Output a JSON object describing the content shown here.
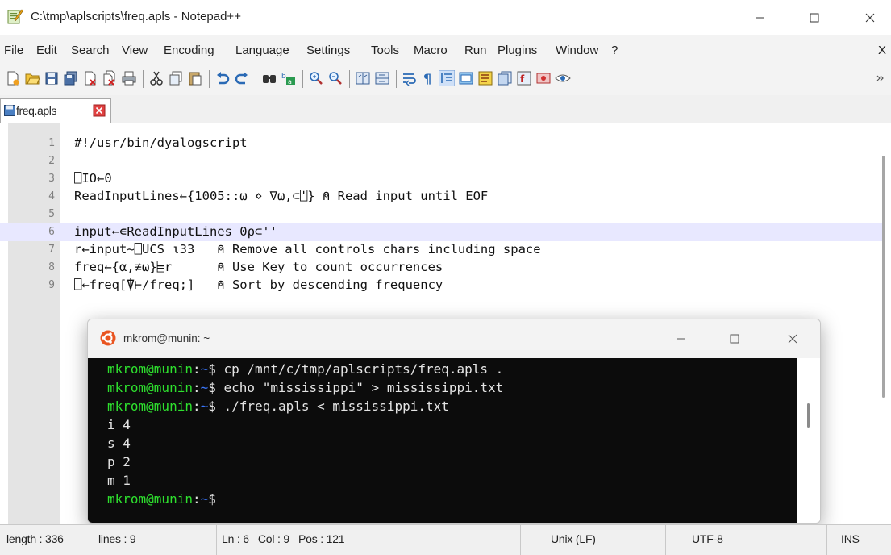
{
  "window": {
    "title": "C:\\tmp\\aplscripts\\freq.apls - Notepad++"
  },
  "menu": [
    "File",
    "Edit",
    "Search",
    "View",
    "Encoding",
    "Language",
    "Settings",
    "Tools",
    "Macro",
    "Run",
    "Plugins",
    "Window",
    "?",
    "X"
  ],
  "toolbar_icons": [
    "new-file-icon",
    "open-file-icon",
    "save-icon",
    "save-all-icon",
    "close-icon",
    "close-all-icon",
    "print-icon",
    "cut-icon",
    "copy-icon",
    "paste-icon",
    "undo-icon",
    "redo-icon",
    "find-icon",
    "replace-icon",
    "zoom-in-icon",
    "zoom-out-icon",
    "sync-vertical-icon",
    "sync-horizontal-icon",
    "word-wrap-icon",
    "show-all-chars-icon",
    "indent-guide-icon",
    "document-map-icon",
    "function-list-icon",
    "folder-workspace-icon",
    "monitor-icon",
    "record-macro-icon",
    "eye-icon",
    "overflow-icon"
  ],
  "tab": {
    "label": "freq.apls"
  },
  "editor": {
    "lines": [
      {
        "num": "1",
        "text": "#!/usr/bin/dyalogscript"
      },
      {
        "num": "2",
        "text": ""
      },
      {
        "num": "3",
        "text": "⎕IO←0"
      },
      {
        "num": "4",
        "text": "ReadInputLines←{1005::⍵ ⋄ ∇⍵,⊂⍞} ⍝ Read input until EOF"
      },
      {
        "num": "5",
        "text": ""
      },
      {
        "num": "6",
        "text": "input←∊ReadInputLines 0⍴⊂''"
      },
      {
        "num": "7",
        "text": "r←input~⎕UCS ⍳33   ⍝ Remove all controls chars including space"
      },
      {
        "num": "8",
        "text": "freq←{⍺,≢⍵}⌸r      ⍝ Use Key to count occurrences"
      },
      {
        "num": "9",
        "text": "⎕←freq[⍒⊢/freq;]   ⍝ Sort by descending frequency"
      }
    ],
    "current_line": 6
  },
  "terminal": {
    "title": "mkrom@munin: ~",
    "lines": [
      {
        "user": "mkrom@munin",
        "sep": ":",
        "path": "~",
        "sym": "$",
        "text": " cp /mnt/c/tmp/aplscripts/freq.apls ."
      },
      {
        "user": "mkrom@munin",
        "sep": ":",
        "path": "~",
        "sym": "$",
        "text": " echo \"mississippi\" > mississippi.txt"
      },
      {
        "user": "mkrom@munin",
        "sep": ":",
        "path": "~",
        "sym": "$",
        "text": " ./freq.apls < mississippi.txt"
      },
      {
        "user": "",
        "sep": "",
        "path": "",
        "sym": "",
        "text": "i 4"
      },
      {
        "user": "",
        "sep": "",
        "path": "",
        "sym": "",
        "text": "s 4"
      },
      {
        "user": "",
        "sep": "",
        "path": "",
        "sym": "",
        "text": "p 2"
      },
      {
        "user": "",
        "sep": "",
        "path": "",
        "sym": "",
        "text": "m 1"
      },
      {
        "user": "mkrom@munin",
        "sep": ":",
        "path": "~",
        "sym": "$",
        "text": ""
      }
    ]
  },
  "status": {
    "length": "length : 336",
    "lines": "lines : 9",
    "position": "Ln : 6   Col : 9   Pos : 121",
    "eol": "Unix (LF)",
    "encoding": "UTF-8",
    "mode": "INS"
  },
  "colors": {
    "terminal_user": "#2ee02e",
    "terminal_path": "#3b78ff",
    "current_line": "#e8e8ff"
  }
}
